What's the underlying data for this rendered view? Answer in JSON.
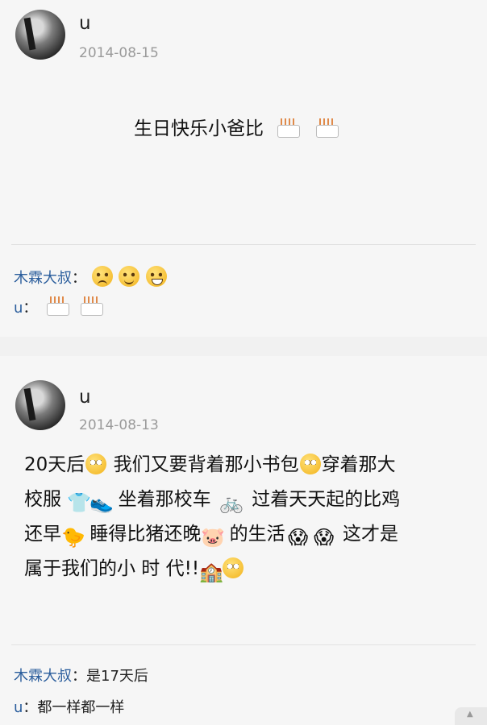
{
  "posts": [
    {
      "username": "u",
      "date": "2014-08-15",
      "content": {
        "text": "生日快乐小爸比",
        "emojis": [
          "cake-icon",
          "cake-icon"
        ]
      },
      "comments": [
        {
          "name": "木霖大叔",
          "sep": "：",
          "text": "",
          "emojis": [
            "crying-face-icon",
            "smiling-face-icon",
            "grinning-face-icon"
          ]
        },
        {
          "name": "u",
          "sep": "：",
          "text": "",
          "emojis": [
            "cake-icon",
            "cake-icon"
          ]
        }
      ]
    },
    {
      "username": "u",
      "date": "2014-08-13",
      "content": {
        "segments": [
          "20天后",
          "我们又要背着那小书包",
          "穿着那大",
          "校服",
          "坐着那校车",
          "过着天天起的比鸡",
          "还早",
          "睡得比猪还晚",
          "的生活",
          "这才是",
          "属于我们的小 时 代!!"
        ],
        "emojis": [
          "flushed-face-icon",
          "flushed-face-icon",
          "shirt-icon",
          "sneaker-icon",
          "bicycle-icon",
          "chick-icon",
          "pig-icon",
          "scream-face-icon",
          "scream-face-icon",
          "building-icon",
          "flushed-face-icon"
        ]
      },
      "comments": [
        {
          "name": "木霖大叔",
          "sep": "：",
          "text": "是17天后"
        },
        {
          "name": "u",
          "sep": "：",
          "text": "都一样都一样"
        }
      ]
    }
  ]
}
